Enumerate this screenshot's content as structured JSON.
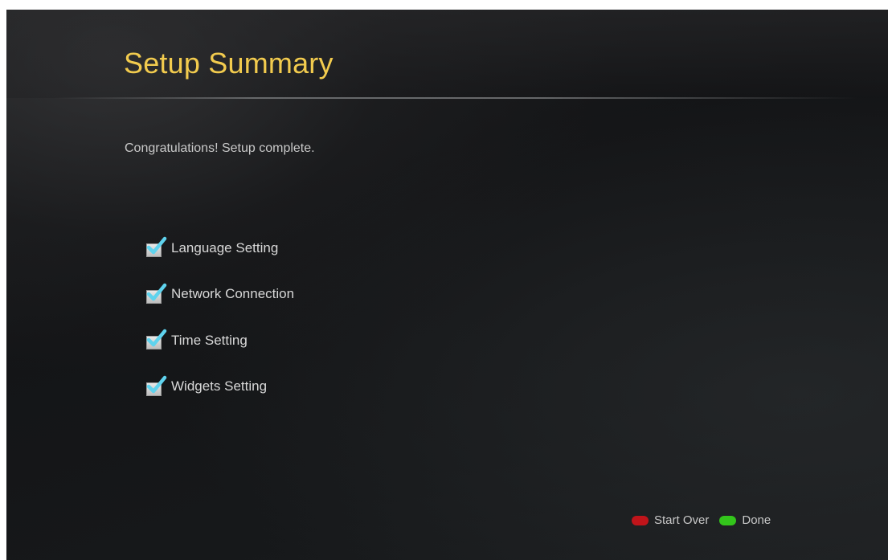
{
  "header": {
    "title": "Setup Summary"
  },
  "main": {
    "message": "Congratulations! Setup complete.",
    "items": [
      {
        "label": "Language Setting",
        "checked": true
      },
      {
        "label": "Network Connection",
        "checked": true
      },
      {
        "label": "Time Setting",
        "checked": true
      },
      {
        "label": "Widgets Setting",
        "checked": true
      }
    ]
  },
  "footer": {
    "start_over_label": "Start Over",
    "done_label": "Done",
    "start_over_color": "#c0141a",
    "done_color": "#33c51b"
  },
  "colors": {
    "title": "#f2cb4e",
    "checkmark": "#5fd3ee"
  }
}
